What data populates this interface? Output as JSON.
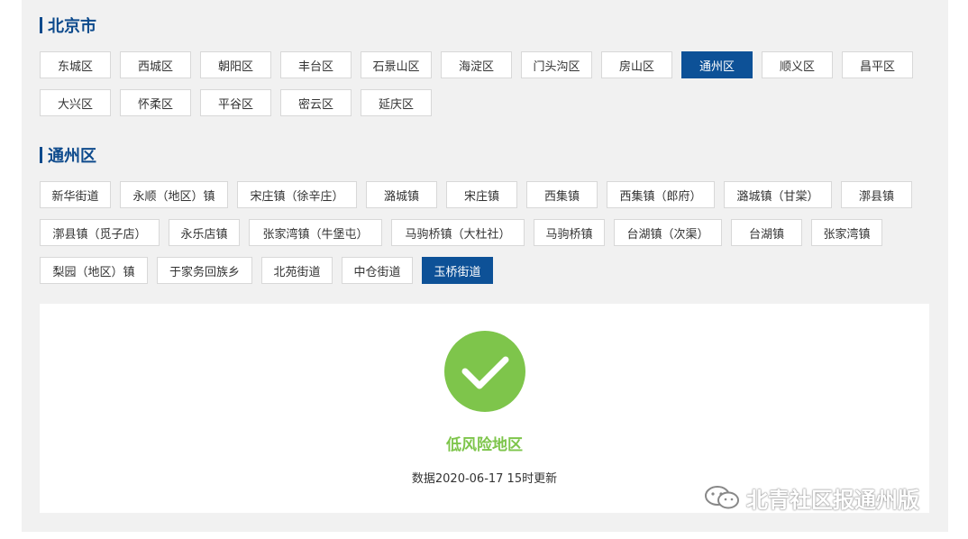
{
  "city_section": {
    "title": "北京市",
    "districts": [
      "东城区",
      "西城区",
      "朝阳区",
      "丰台区",
      "石景山区",
      "海淀区",
      "门头沟区",
      "房山区",
      "通州区",
      "顺义区",
      "昌平区",
      "大兴区",
      "怀柔区",
      "平谷区",
      "密云区",
      "延庆区"
    ],
    "selected": "通州区"
  },
  "district_section": {
    "title": "通州区",
    "towns": [
      "新华街道",
      "永顺（地区）镇",
      "宋庄镇（徐辛庄）",
      "潞城镇",
      "宋庄镇",
      "西集镇",
      "西集镇（郎府）",
      "潞城镇（甘棠）",
      "漷县镇",
      "漷县镇（觅子店）",
      "永乐店镇",
      "张家湾镇（牛堡屯）",
      "马驹桥镇（大杜社）",
      "马驹桥镇",
      "台湖镇（次渠）",
      "台湖镇",
      "张家湾镇",
      "梨园（地区）镇",
      "于家务回族乡",
      "北苑街道",
      "中仓街道",
      "玉桥街道"
    ],
    "selected": "玉桥街道"
  },
  "result": {
    "icon": "check-icon",
    "risk_level": "低风险地区",
    "updated": "数据2020-06-17 15时更新",
    "color": "#7ec54b"
  },
  "watermark": {
    "text": "北青社区报通州版",
    "icon": "wechat-icon"
  },
  "colors": {
    "accent": "#0d5197",
    "title": "#0d4a8c",
    "low_risk": "#7ec54b"
  }
}
